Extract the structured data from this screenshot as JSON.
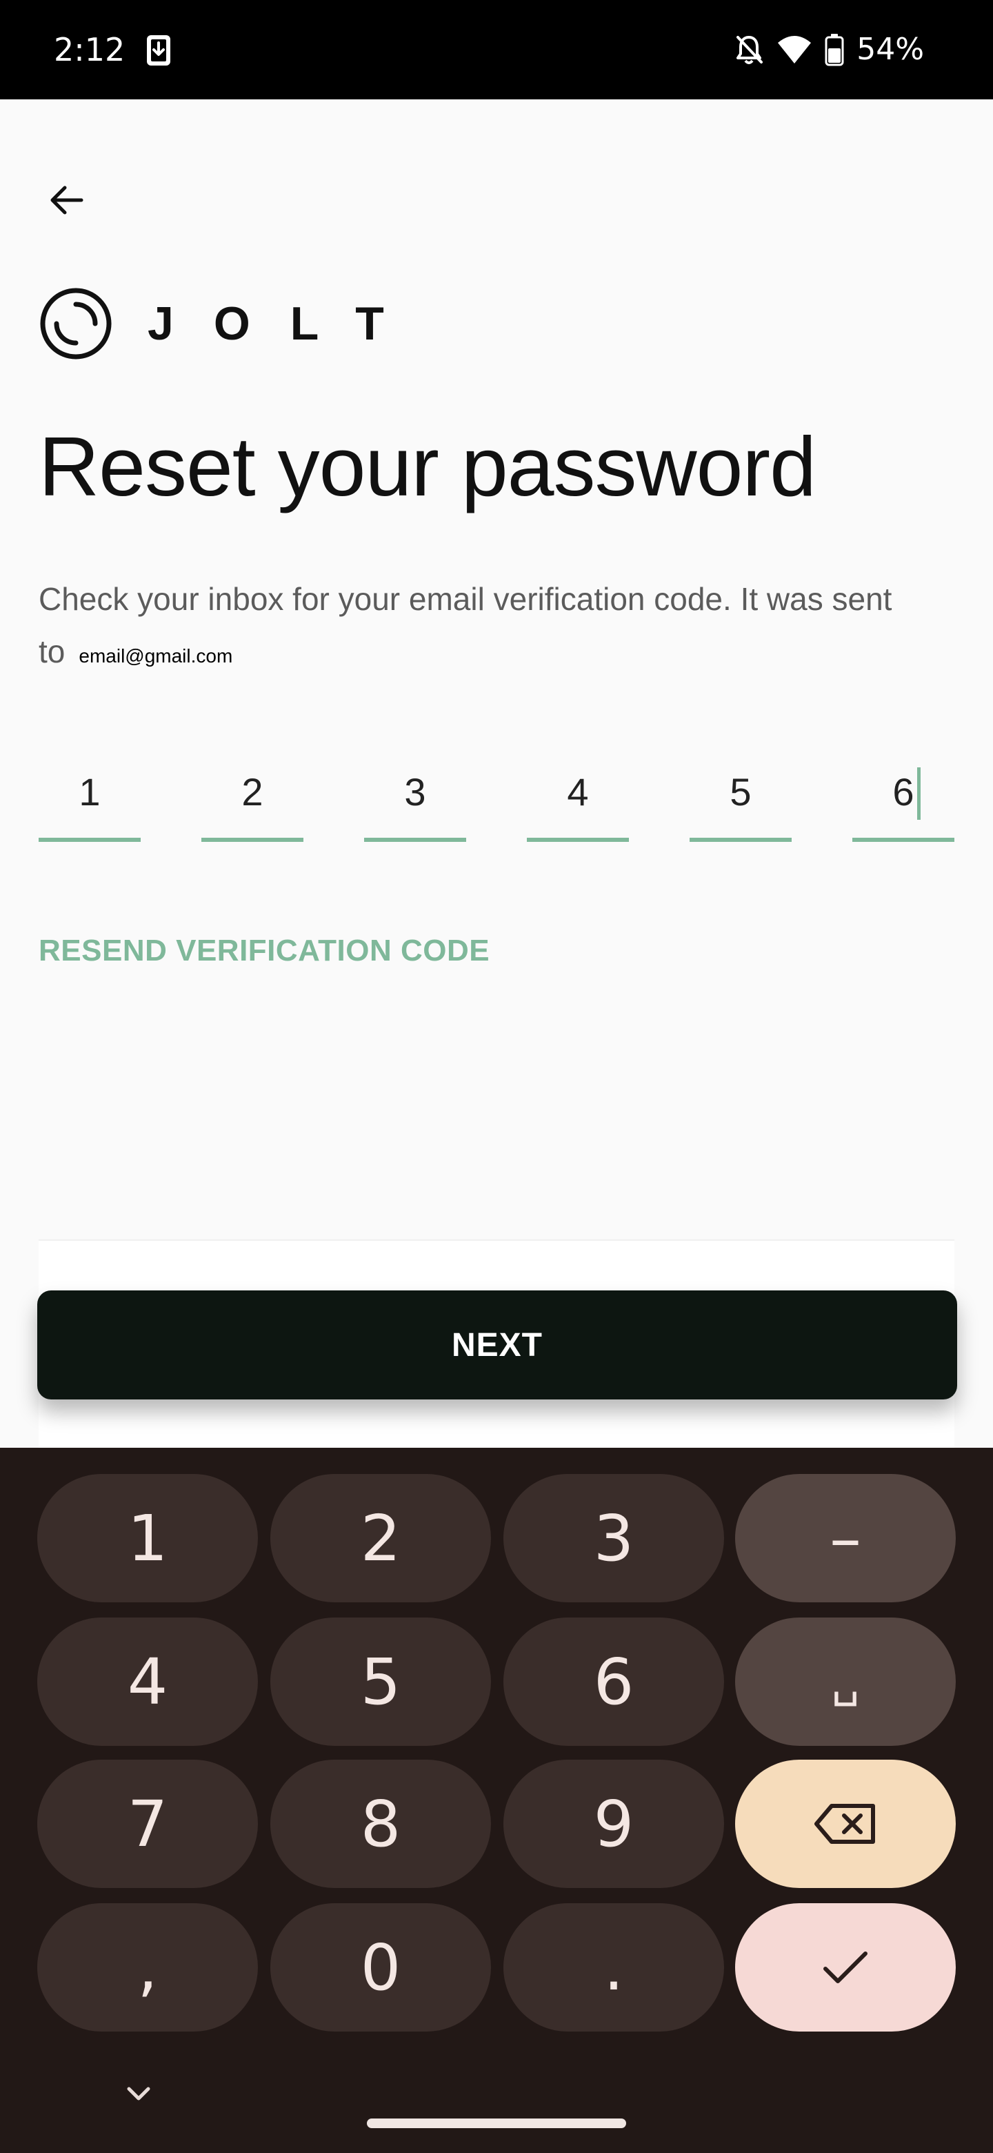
{
  "status_bar": {
    "time": "2:12",
    "battery": "54%"
  },
  "icons": {
    "download": "download-icon",
    "silent": "bell-off-icon",
    "wifi": "wifi-icon",
    "battery": "battery-icon",
    "back": "arrow-left-icon",
    "logo": "jolt-logo-icon",
    "backspace": "backspace-icon",
    "enter": "check-icon",
    "hide_keyboard": "chevron-down-icon"
  },
  "brand": {
    "name": "JOLT"
  },
  "page": {
    "title": "Reset your password",
    "description": "Check your inbox for your email verification code. It was sent to",
    "email": "email@gmail.com"
  },
  "otp": {
    "digits": [
      "1",
      "2",
      "3",
      "4",
      "5",
      "6"
    ]
  },
  "resend_label": "RESEND VERIFICATION CODE",
  "next_label": "NEXT",
  "keyboard": {
    "keys": [
      "1",
      "2",
      "3",
      "–",
      "4",
      "5",
      "6",
      "␣",
      "7",
      "8",
      "9",
      ",",
      "0",
      "."
    ]
  },
  "colors": {
    "accent": "#7fb89a",
    "button": "#0d1611",
    "keyboard_bg": "#221816",
    "key": "#3a2d2a",
    "key_func": "#544541",
    "key_backspace": "#f6dcbb",
    "key_enter": "#f6d9d5"
  }
}
